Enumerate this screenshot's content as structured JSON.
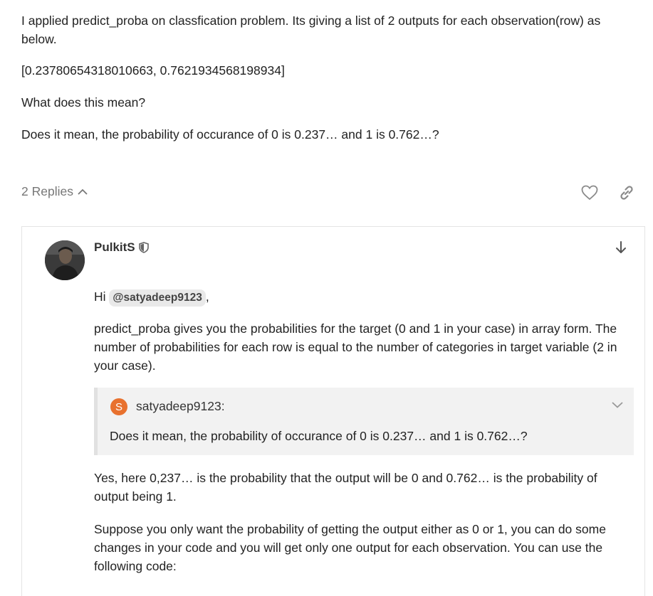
{
  "question": {
    "para1": "I applied predict_proba on classfication problem. Its giving a list of 2 outputs for each observation(row) as below.",
    "para2": "[0.23780654318010663, 0.7621934568198934]",
    "para3": "What does this mean?",
    "para4": "Does it mean, the probability of occurance of 0 is 0.237… and 1 is 0.762…?"
  },
  "actions": {
    "replies_label": "2 Replies",
    "like_icon": "heart-icon",
    "link_icon": "link-icon"
  },
  "reply": {
    "username": "PulkitS",
    "user_badge_icon": "shield-icon",
    "greeting_prefix": "Hi",
    "mention": "@satyadeep9123",
    "greeting_suffix": ",",
    "para1": "predict_proba gives you the probabilities for the target (0 and 1 in your case) in array form. The number of probabilities for each row is equal to the number of categories in target variable (2 in your case).",
    "quote": {
      "avatar_letter": "S",
      "avatar_color": "#e8712e",
      "username": "satyadeep9123:",
      "text": "Does it mean, the probability of occurance of 0 is 0.237… and 1 is 0.762…?"
    },
    "para2": "Yes, here 0,237… is the probability that the output will be 0 and 0.762… is the probability of output being 1.",
    "para3": "Suppose you only want the probability of getting the output either as 0 or 1, you can do some changes in your code and you will get only one output for each observation. You can use the following code:"
  }
}
